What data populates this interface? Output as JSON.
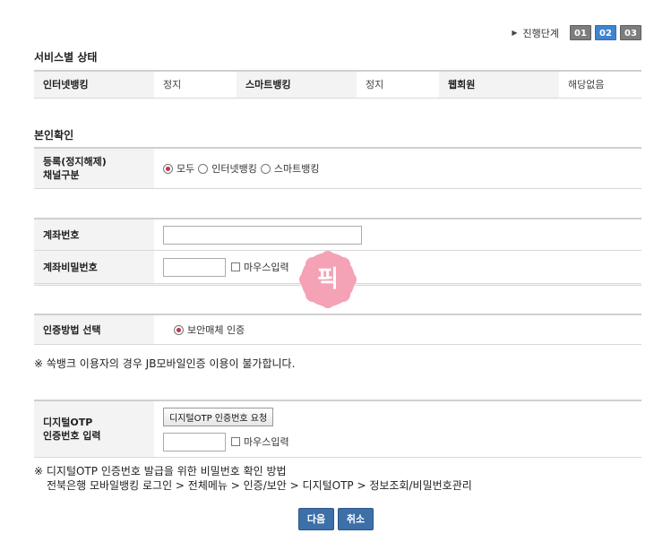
{
  "progress": {
    "label": "진행단계",
    "steps": [
      "01",
      "02",
      "03"
    ],
    "current": "02"
  },
  "service_status": {
    "title": "서비스별 상태",
    "items": [
      {
        "label": "인터넷뱅킹",
        "value": "정지"
      },
      {
        "label": "스마트뱅킹",
        "value": "정지"
      },
      {
        "label": "웹회원",
        "value": "해당없음"
      }
    ]
  },
  "identity": {
    "title": "본인확인",
    "channel": {
      "label": "등록(정지해제)\n채널구분",
      "options": [
        "모두",
        "인터넷뱅킹",
        "스마트뱅킹"
      ],
      "selected": "모두"
    },
    "account_number": {
      "label": "계좌번호",
      "value": ""
    },
    "account_password": {
      "label": "계좌비밀번호",
      "value": "",
      "mouse_input": "마우스입력"
    },
    "auth_method": {
      "label": "인증방법 선택",
      "option": "보안매체 인증",
      "selected": true
    },
    "note": "※ 쏙뱅크 이용자의 경우 JB모바일인증 이용이 불가합니다.",
    "otp": {
      "label": "디지털OTP\n인증번호 입력",
      "request_button": "디지털OTP 인증번호 요청",
      "value": "",
      "mouse_input": "마우스입력"
    },
    "otp_note": "※ 디지털OTP 인증번호 발급을 위한 비밀번호 확인 방법",
    "otp_path": "전북은행 모바일뱅킹 로그인 > 전체메뉴 > 인증/보안 > 디지털OTP > 정보조회/비밀번호관리"
  },
  "stamp": {
    "text": "픽",
    "color": "#f28ba6"
  },
  "actions": {
    "next": "다음",
    "cancel": "취소"
  }
}
